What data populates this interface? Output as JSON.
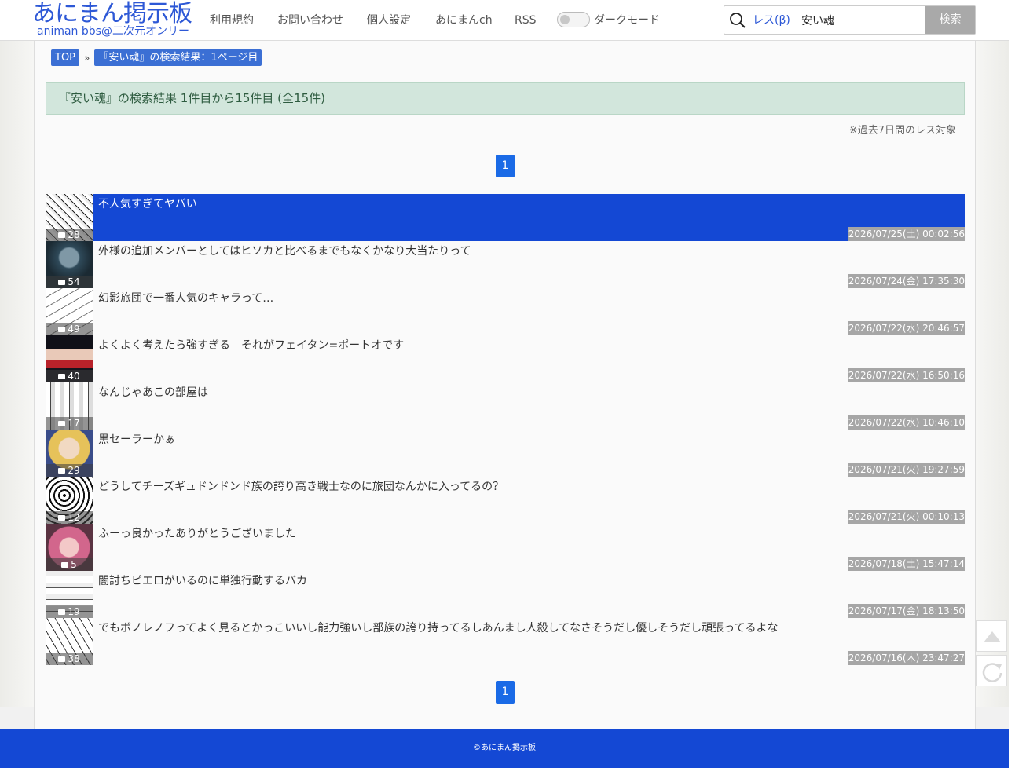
{
  "header": {
    "logo": "あにまん掲示板",
    "logo_sub": "animan bbs@二次元オンリー",
    "nav": [
      "利用規約",
      "お問い合わせ",
      "個人設定",
      "あにまんch",
      "RSS"
    ],
    "dark_mode_label": "ダークモード",
    "search_scope": "レス(β)",
    "search_value": "安い魂",
    "search_button": "検索"
  },
  "breadcrumb": {
    "top": "TOP",
    "sep": "»",
    "current": "『安い魂』の検索結果：1ページ目"
  },
  "result_banner": "『安い魂』の検索結果 1件目から15件目 (全15件)",
  "note": "※過去7日間のレス対象",
  "pager_top": "1",
  "pager_bottom": "1",
  "threads": [
    {
      "title": "不人気すぎてヤバい",
      "count": "28",
      "date": "2026/07/25(土) 00:02:56"
    },
    {
      "title": "外様の追加メンバーとしてはヒソカと比べるまでもなくかなり大当たりって",
      "count": "54",
      "date": "2026/07/24(金) 17:35:30"
    },
    {
      "title": "幻影旅団で一番人気のキャラって…",
      "count": "49",
      "date": "2026/07/22(水) 20:46:57"
    },
    {
      "title": "よくよく考えたら強すぎる　それがフェイタン=ポートオです",
      "count": "40",
      "date": "2026/07/22(水) 16:50:16"
    },
    {
      "title": "なんじゃあこの部屋は",
      "count": "17",
      "date": "2026/07/22(水) 10:46:10"
    },
    {
      "title": "黒セーラーかぁ",
      "count": "29",
      "date": "2026/07/21(火) 19:27:59"
    },
    {
      "title": "どうしてチーズギュドンドンド族の誇り高き戦士なのに旅団なんかに入ってるの？",
      "count": "12",
      "date": "2026/07/21(火) 00:10:13"
    },
    {
      "title": "ふーっ良かったありがとうございました",
      "count": "5",
      "date": "2026/07/18(土) 15:47:14"
    },
    {
      "title": "闇討ちピエロがいるのに単独行動するバカ",
      "count": "19",
      "date": "2026/07/17(金) 18:13:50"
    },
    {
      "title": "でもボノレノフってよく見るとかっこいいし能力強いし部族の誇り持ってるしあんまし人殺してなさそうだし優しそうだし頑張ってるよな",
      "count": "38",
      "date": "2026/07/16(木) 23:47:27"
    }
  ],
  "footer": "©あにまん掲示板",
  "colors": {
    "brand": "#2d58d6",
    "active_row": "#1448d4",
    "pager": "#1a6ae6",
    "banner_bg": "#d2e6dc"
  }
}
